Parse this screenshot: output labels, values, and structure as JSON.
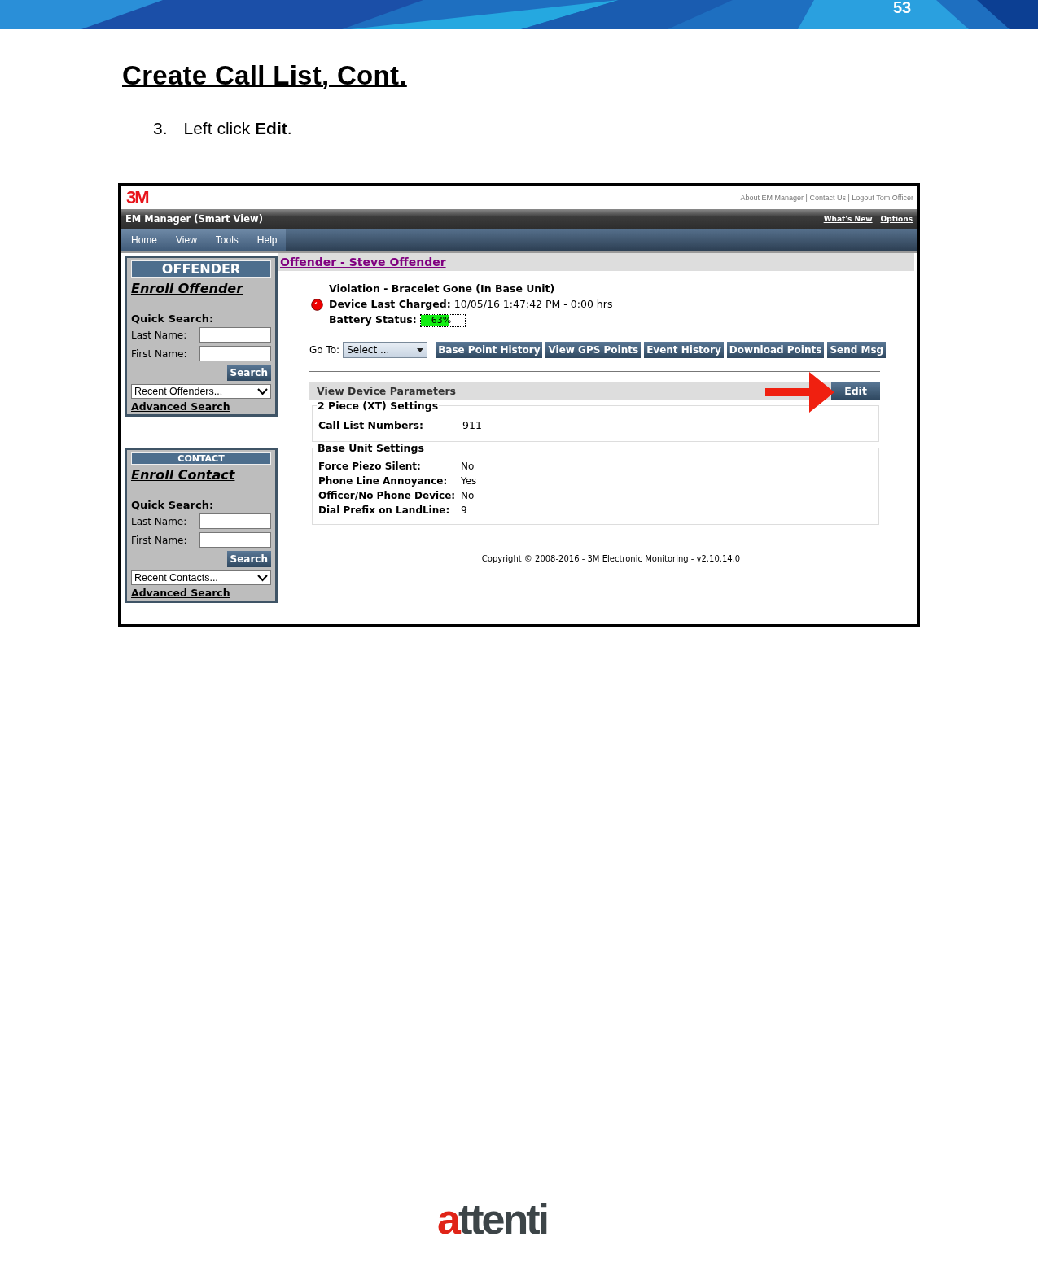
{
  "page_number": "53",
  "heading": "Create Call List, Cont.",
  "steps": [
    {
      "number": "3.",
      "text": "Left click **Edit**."
    }
  ],
  "app": {
    "logo": "3M",
    "top_links": "About EM Manager | Contact Us | Logout Tom Officer",
    "title": "EM Manager (Smart View)",
    "title_links": [
      "What's New",
      "Options"
    ],
    "menu": [
      "Home",
      "View",
      "Tools",
      "Help"
    ],
    "sidebar": [
      {
        "kind": "large",
        "heading": "OFFENDER",
        "enroll": "Enroll Offender",
        "quick_search": "Quick Search:",
        "fields": [
          "Last Name:",
          "First Name:"
        ],
        "button": "Search",
        "dropdown": "Recent Offenders...",
        "advanced": "Advanced Search"
      },
      {
        "kind": "small",
        "heading": "CONTACT",
        "enroll": "Enroll Contact",
        "quick_search": "Quick Search:",
        "fields": [
          "Last Name:",
          "First Name:"
        ],
        "button": "Search",
        "dropdown": "Recent Contacts...",
        "advanced": "Advanced Search"
      }
    ],
    "offender_title": "Offender - Steve Offender",
    "status": {
      "violation": "Violation - Bracelet Gone (In Base Unit)",
      "charged_label": "Device Last Charged:",
      "charged_value": "10/05/16 1:47:42 PM - 0:00 hrs",
      "battery_label": "Battery Status:",
      "battery": {
        "level": 0.63,
        "reading": "63%"
      }
    },
    "goto": {
      "label": "Go To:",
      "value": "Select ..."
    },
    "actions": [
      "Base Point History",
      "View GPS Points",
      "Event History",
      "Download Points",
      "Send Msg"
    ],
    "parameters": {
      "title": "View Device Parameters",
      "edit": "Edit",
      "groups": [
        {
          "title": "2 Piece (XT) Settings",
          "rows": [
            {
              "label": "Call List Numbers:",
              "value": "911"
            }
          ]
        },
        {
          "title": "Base Unit Settings",
          "rows": [
            {
              "label": "Force Piezo Silent:",
              "value": "No"
            },
            {
              "label": "Phone Line Annoyance:",
              "value": "Yes"
            },
            {
              "label": "Officer/No Phone Device:",
              "value": "No"
            },
            {
              "label": "Dial Prefix on LandLine:",
              "value": "9"
            }
          ]
        }
      ]
    },
    "copyright": "Copyright © 2008-2016 - 3M Electronic Monitoring - v2.10.14.0"
  },
  "footer_logo": {
    "accent": "a",
    "rest": "ttenti"
  }
}
